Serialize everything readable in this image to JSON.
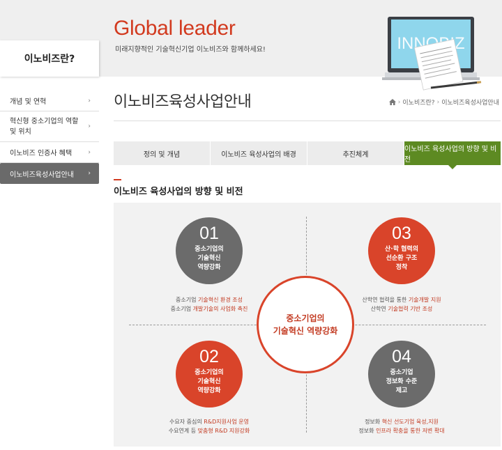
{
  "header": {
    "title": "Global leader",
    "subtitle": "미래지향적인 기술혁신기업 이노비즈와 함께하세요!",
    "illustration_text": "INNOBIZ"
  },
  "sidebar": {
    "title": "이노비즈란?",
    "items": [
      {
        "label": "개념 및 연혁"
      },
      {
        "label": "혁신형 중소기업의 역할 및 위치"
      },
      {
        "label": "이노비즈 인증사 혜택"
      },
      {
        "label": "이노비즈육성사업안내",
        "active": true
      }
    ],
    "arrow": "›"
  },
  "page": {
    "title": "이노비즈육성사업안내",
    "breadcrumb": {
      "home_icon": "home-icon",
      "parent": "이노비즈란?",
      "current": "이노비즈육성사업안내",
      "sep": "›"
    }
  },
  "tabs": [
    {
      "label": "정의 및 개념"
    },
    {
      "label": "이노비즈 육성사업의 배경"
    },
    {
      "label": "추진체계"
    },
    {
      "label": "이노비즈 육성사업의 방향 및 비전",
      "active": true
    }
  ],
  "section": {
    "title": "이노비즈 육성사업의 방향 및 비전"
  },
  "diagram": {
    "center": "중소기업의\n기술혁신 역량강화",
    "items": [
      {
        "num": "01",
        "label": "중소기업의\n기술혁신\n역량강화",
        "line1_pre": "중소기업 ",
        "line1_hl": "기술혁신 환경 조성",
        "line1_post": "",
        "line2_pre": "중소기업 ",
        "line2_hl": "개발기술의 사업화 촉진",
        "line2_post": ""
      },
      {
        "num": "03",
        "label": "산·학 협력의\n선순환 구조\n정착",
        "line1_pre": "산학연 협력을 통한 ",
        "line1_hl": "기술개발 지원",
        "line1_post": "",
        "line2_pre": "산학연 ",
        "line2_hl": "기술협력 기반 조성",
        "line2_post": ""
      },
      {
        "num": "02",
        "label": "중소기업의\n기술혁신\n역량강화",
        "line1_pre": "수요자 중심의 ",
        "line1_hl": "R&D지원사업 운영",
        "line1_post": "",
        "line2_pre": "수요연계 등 ",
        "line2_hl": "맞춤형 R&D 지원강화",
        "line2_post": ""
      },
      {
        "num": "04",
        "label": "중소기업\n정보화 수준\n제고",
        "line1_pre": "정보화 ",
        "line1_hl": "혁신 선도기업 육성,지원",
        "line1_post": "",
        "line2_pre": "정보화 ",
        "line2_hl": "인프라 확충을 통한 저변 확대",
        "line2_post": ""
      }
    ],
    "colors": {
      "red": "#d9442a",
      "grey": "#6b6b6b",
      "accent_green": "#5d8a22",
      "brand_red": "#d23a1f"
    }
  }
}
